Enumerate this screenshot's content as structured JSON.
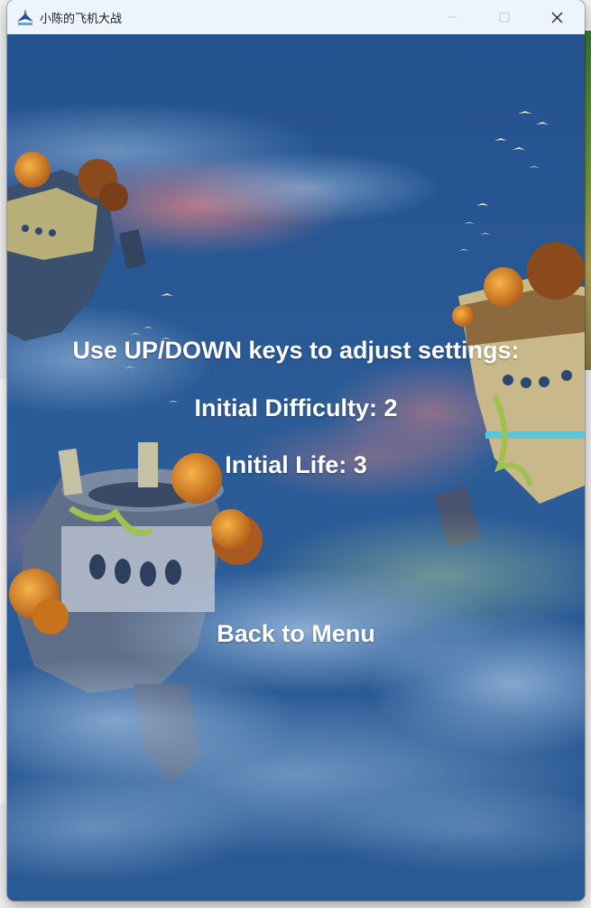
{
  "window": {
    "title": "小陈的飞机大战"
  },
  "settings": {
    "prompt": "Use UP/DOWN keys to adjust settings:",
    "difficulty_line": "Initial Difficulty: 2",
    "life_line": "Initial Life: 3",
    "back_label": "Back to Menu"
  },
  "icons": {
    "app": "airplane-icon",
    "minimize": "minimize-icon",
    "maximize": "maximize-icon",
    "close": "close-icon"
  },
  "colors": {
    "sky": "#2a5a95",
    "titlebar": "#eef4fb",
    "text": "#ffffff"
  }
}
